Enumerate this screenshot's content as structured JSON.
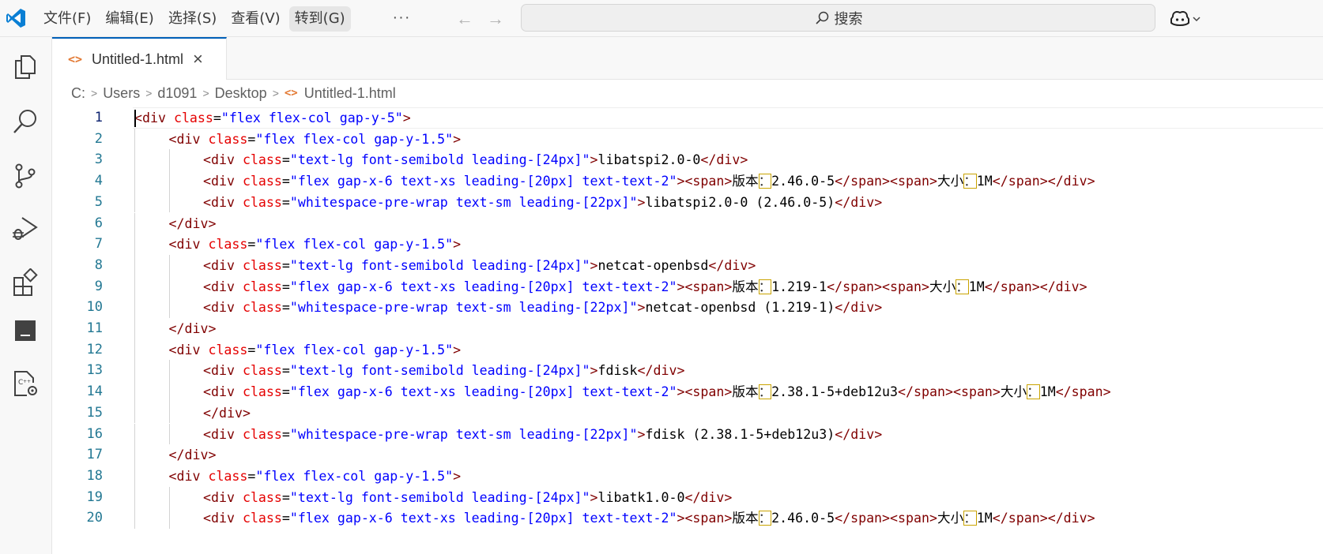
{
  "menu": {
    "items": [
      "文件(F)",
      "编辑(E)",
      "选择(S)",
      "查看(V)",
      "转到(G)"
    ],
    "more": "···"
  },
  "search": {
    "label": "搜索"
  },
  "tab": {
    "label": "Untitled-1.html",
    "close": "×"
  },
  "breadcrumb": [
    "C:",
    "Users",
    "d1091",
    "Desktop",
    "Untitled-1.html"
  ],
  "editor": {
    "active_line": 1,
    "lines": [
      {
        "n": "1",
        "indent": 0,
        "tokens": [
          [
            "t",
            "<div "
          ],
          [
            "a",
            "class"
          ],
          [
            "x",
            "="
          ],
          [
            "s",
            "\"flex flex-col gap-y-5\""
          ],
          [
            "t",
            ">"
          ]
        ]
      },
      {
        "n": "2",
        "indent": 1,
        "tokens": [
          [
            "t",
            "<div "
          ],
          [
            "a",
            "class"
          ],
          [
            "x",
            "="
          ],
          [
            "s",
            "\"flex flex-col gap-y-1.5\""
          ],
          [
            "t",
            ">"
          ]
        ]
      },
      {
        "n": "3",
        "indent": 2,
        "tokens": [
          [
            "t",
            "<div "
          ],
          [
            "a",
            "class"
          ],
          [
            "x",
            "="
          ],
          [
            "s",
            "\"text-lg font-semibold leading-[24px]\""
          ],
          [
            "t",
            ">"
          ],
          [
            "x",
            "libatspi2.0-0"
          ],
          [
            "t",
            "</div>"
          ]
        ]
      },
      {
        "n": "4",
        "indent": 2,
        "tokens": [
          [
            "t",
            "<div "
          ],
          [
            "a",
            "class"
          ],
          [
            "x",
            "="
          ],
          [
            "s",
            "\"flex gap-x-6 text-xs leading-[20px] text-text-2\""
          ],
          [
            "t",
            ">"
          ],
          [
            "t",
            "<span>"
          ],
          [
            "cj",
            "版本"
          ],
          [
            "hl",
            "："
          ],
          [
            "x",
            "2.46.0-5"
          ],
          [
            "t",
            "</span>"
          ],
          [
            "t",
            "<span>"
          ],
          [
            "cj",
            "大小"
          ],
          [
            "hl",
            "："
          ],
          [
            "x",
            "1M"
          ],
          [
            "t",
            "</span>"
          ],
          [
            "t",
            "</div>"
          ]
        ]
      },
      {
        "n": "5",
        "indent": 2,
        "tokens": [
          [
            "t",
            "<div "
          ],
          [
            "a",
            "class"
          ],
          [
            "x",
            "="
          ],
          [
            "s",
            "\"whitespace-pre-wrap text-sm leading-[22px]\""
          ],
          [
            "t",
            ">"
          ],
          [
            "x",
            "libatspi2.0-0 (2.46.0-5)"
          ],
          [
            "t",
            "</div>"
          ]
        ]
      },
      {
        "n": "6",
        "indent": 1,
        "tokens": [
          [
            "t",
            "</div>"
          ]
        ]
      },
      {
        "n": "7",
        "indent": 1,
        "tokens": [
          [
            "t",
            "<div "
          ],
          [
            "a",
            "class"
          ],
          [
            "x",
            "="
          ],
          [
            "s",
            "\"flex flex-col gap-y-1.5\""
          ],
          [
            "t",
            ">"
          ]
        ]
      },
      {
        "n": "8",
        "indent": 2,
        "tokens": [
          [
            "t",
            "<div "
          ],
          [
            "a",
            "class"
          ],
          [
            "x",
            "="
          ],
          [
            "s",
            "\"text-lg font-semibold leading-[24px]\""
          ],
          [
            "t",
            ">"
          ],
          [
            "x",
            "netcat-openbsd"
          ],
          [
            "t",
            "</div>"
          ]
        ]
      },
      {
        "n": "9",
        "indent": 2,
        "tokens": [
          [
            "t",
            "<div "
          ],
          [
            "a",
            "class"
          ],
          [
            "x",
            "="
          ],
          [
            "s",
            "\"flex gap-x-6 text-xs leading-[20px] text-text-2\""
          ],
          [
            "t",
            ">"
          ],
          [
            "t",
            "<span>"
          ],
          [
            "cj",
            "版本"
          ],
          [
            "hl",
            "："
          ],
          [
            "x",
            "1.219-1"
          ],
          [
            "t",
            "</span>"
          ],
          [
            "t",
            "<span>"
          ],
          [
            "cj",
            "大小"
          ],
          [
            "hl",
            "："
          ],
          [
            "x",
            "1M"
          ],
          [
            "t",
            "</span>"
          ],
          [
            "t",
            "</div>"
          ]
        ]
      },
      {
        "n": "10",
        "indent": 2,
        "tokens": [
          [
            "t",
            "<div "
          ],
          [
            "a",
            "class"
          ],
          [
            "x",
            "="
          ],
          [
            "s",
            "\"whitespace-pre-wrap text-sm leading-[22px]\""
          ],
          [
            "t",
            ">"
          ],
          [
            "x",
            "netcat-openbsd (1.219-1)"
          ],
          [
            "t",
            "</div>"
          ]
        ]
      },
      {
        "n": "11",
        "indent": 1,
        "tokens": [
          [
            "t",
            "</div>"
          ]
        ]
      },
      {
        "n": "12",
        "indent": 1,
        "tokens": [
          [
            "t",
            "<div "
          ],
          [
            "a",
            "class"
          ],
          [
            "x",
            "="
          ],
          [
            "s",
            "\"flex flex-col gap-y-1.5\""
          ],
          [
            "t",
            ">"
          ]
        ]
      },
      {
        "n": "13",
        "indent": 2,
        "tokens": [
          [
            "t",
            "<div "
          ],
          [
            "a",
            "class"
          ],
          [
            "x",
            "="
          ],
          [
            "s",
            "\"text-lg font-semibold leading-[24px]\""
          ],
          [
            "t",
            ">"
          ],
          [
            "x",
            "fdisk"
          ],
          [
            "t",
            "</div>"
          ]
        ]
      },
      {
        "n": "14",
        "indent": 2,
        "tokens": [
          [
            "t",
            "<div "
          ],
          [
            "a",
            "class"
          ],
          [
            "x",
            "="
          ],
          [
            "s",
            "\"flex gap-x-6 text-xs leading-[20px] text-text-2\""
          ],
          [
            "t",
            ">"
          ],
          [
            "t",
            "<span>"
          ],
          [
            "cj",
            "版本"
          ],
          [
            "hl",
            "："
          ],
          [
            "x",
            "2.38.1-5+deb12u3"
          ],
          [
            "t",
            "</span>"
          ],
          [
            "t",
            "<span>"
          ],
          [
            "cj",
            "大小"
          ],
          [
            "hl",
            "："
          ],
          [
            "x",
            "1M"
          ],
          [
            "t",
            "</span>"
          ]
        ]
      },
      {
        "n": "15",
        "indent": 2,
        "tokens": [
          [
            "t",
            "</div>"
          ]
        ]
      },
      {
        "n": "16",
        "indent": 2,
        "tokens": [
          [
            "t",
            "<div "
          ],
          [
            "a",
            "class"
          ],
          [
            "x",
            "="
          ],
          [
            "s",
            "\"whitespace-pre-wrap text-sm leading-[22px]\""
          ],
          [
            "t",
            ">"
          ],
          [
            "x",
            "fdisk (2.38.1-5+deb12u3)"
          ],
          [
            "t",
            "</div>"
          ]
        ]
      },
      {
        "n": "17",
        "indent": 1,
        "tokens": [
          [
            "t",
            "</div>"
          ]
        ]
      },
      {
        "n": "18",
        "indent": 1,
        "tokens": [
          [
            "t",
            "<div "
          ],
          [
            "a",
            "class"
          ],
          [
            "x",
            "="
          ],
          [
            "s",
            "\"flex flex-col gap-y-1.5\""
          ],
          [
            "t",
            ">"
          ]
        ]
      },
      {
        "n": "19",
        "indent": 2,
        "tokens": [
          [
            "t",
            "<div "
          ],
          [
            "a",
            "class"
          ],
          [
            "x",
            "="
          ],
          [
            "s",
            "\"text-lg font-semibold leading-[24px]\""
          ],
          [
            "t",
            ">"
          ],
          [
            "x",
            "libatk1.0-0"
          ],
          [
            "t",
            "</div>"
          ]
        ]
      },
      {
        "n": "20",
        "indent": 2,
        "tokens": [
          [
            "t",
            "<div "
          ],
          [
            "a",
            "class"
          ],
          [
            "x",
            "="
          ],
          [
            "s",
            "\"flex gap-x-6 text-xs leading-[20px] text-text-2\""
          ],
          [
            "t",
            ">"
          ],
          [
            "t",
            "<span>"
          ],
          [
            "cj",
            "版本"
          ],
          [
            "hl",
            "："
          ],
          [
            "x",
            "2.46.0-5"
          ],
          [
            "t",
            "</span>"
          ],
          [
            "t",
            "<span>"
          ],
          [
            "cj",
            "大小"
          ],
          [
            "hl",
            "："
          ],
          [
            "x",
            "1M"
          ],
          [
            "t",
            "</span>"
          ],
          [
            "t",
            "</div>"
          ]
        ]
      }
    ]
  },
  "colors": {
    "tag": "#800000",
    "attribute": "#e50000",
    "string": "#0000ff",
    "text": "#000000",
    "line_number": "#237893",
    "accent": "#005fb8",
    "html_icon": "#e37933"
  },
  "icons": {
    "logo": "vscode-logo-icon",
    "explorer": "files-icon",
    "search": "search-icon",
    "source_control": "source-control-icon",
    "run_debug": "run-debug-icon",
    "extensions": "extensions-icon",
    "panel": "panel-icon",
    "remote": "remote-settings-icon",
    "copilot": "copilot-icon"
  }
}
